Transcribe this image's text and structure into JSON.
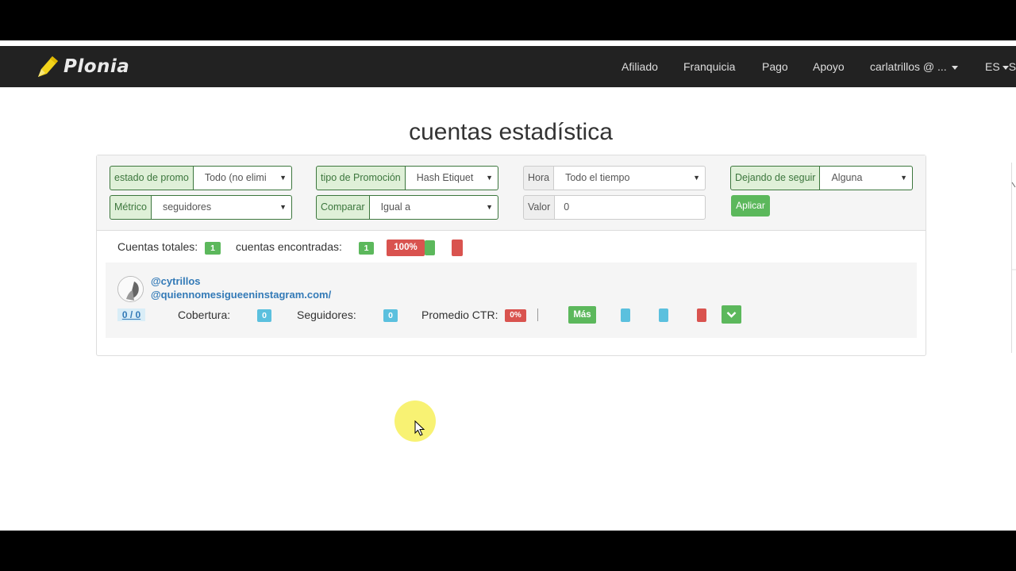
{
  "brand": {
    "name": "Plonia",
    "icon": "pencil-logo-icon"
  },
  "nav": {
    "items": [
      "Afiliado",
      "Franquicia",
      "Pago",
      "Apoyo"
    ],
    "user": "carlatrillos @ ...",
    "lang": "ES",
    "cut": "S"
  },
  "page": {
    "title": "cuentas estadística"
  },
  "filters": {
    "estado": {
      "label": "estado de promo",
      "value": "Todo (no elimi"
    },
    "tipo": {
      "label": "tipo de Promoción",
      "value": "Hash Etiquet"
    },
    "hora": {
      "label": "Hora",
      "value": "Todo el tiempo"
    },
    "dejando": {
      "label": "Dejando de seguir",
      "value": "Alguna"
    },
    "metrico": {
      "label": "Métrico",
      "value": "seguidores"
    },
    "comparar": {
      "label": "Comparar",
      "value": "Igual a"
    },
    "valor": {
      "label": "Valor",
      "value": "0"
    },
    "apply_label": "Aplicar"
  },
  "summary": {
    "total_label": "Cuentas totales:",
    "total_value": "1",
    "found_label": "cuentas encontradas:",
    "found_value": "1",
    "percent": "100%"
  },
  "account": {
    "handle": "@cytrillos",
    "promo": "@quiennomesigueeninstagram.com/",
    "counter": "0 / 0",
    "cobertura_label": "Cobertura:",
    "cobertura_value": "0",
    "seguidores_label": "Seguidores:",
    "seguidores_value": "0",
    "ctr_label": "Promedio CTR:",
    "ctr_value": "0%",
    "more_label": "Más",
    "divider": "|"
  },
  "colors": {
    "navbar": "#222222",
    "success": "#5cb85c",
    "danger": "#d9534f",
    "info": "#5bc0de",
    "link": "#337ab7"
  }
}
